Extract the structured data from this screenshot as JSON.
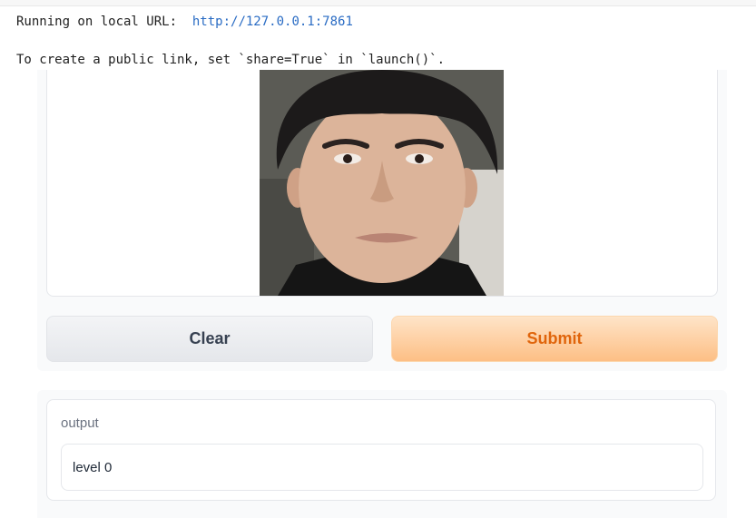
{
  "console": {
    "running_prefix": "Running on local URL:  ",
    "local_url": "http://127.0.0.1:7861",
    "share_hint": "To create a public link, set `share=True` in `launch()`."
  },
  "image_input": {
    "icon": "face-photo",
    "colors": {
      "skin": "#dcb49a",
      "hair": "#1c1a1a",
      "background": "#5b5b55",
      "shirt": "#151515"
    }
  },
  "buttons": {
    "clear_label": "Clear",
    "submit_label": "Submit"
  },
  "output": {
    "label": "output",
    "value": "level 0"
  },
  "colors": {
    "submit_text": "#e0650c",
    "link": "#2a6cc4"
  }
}
